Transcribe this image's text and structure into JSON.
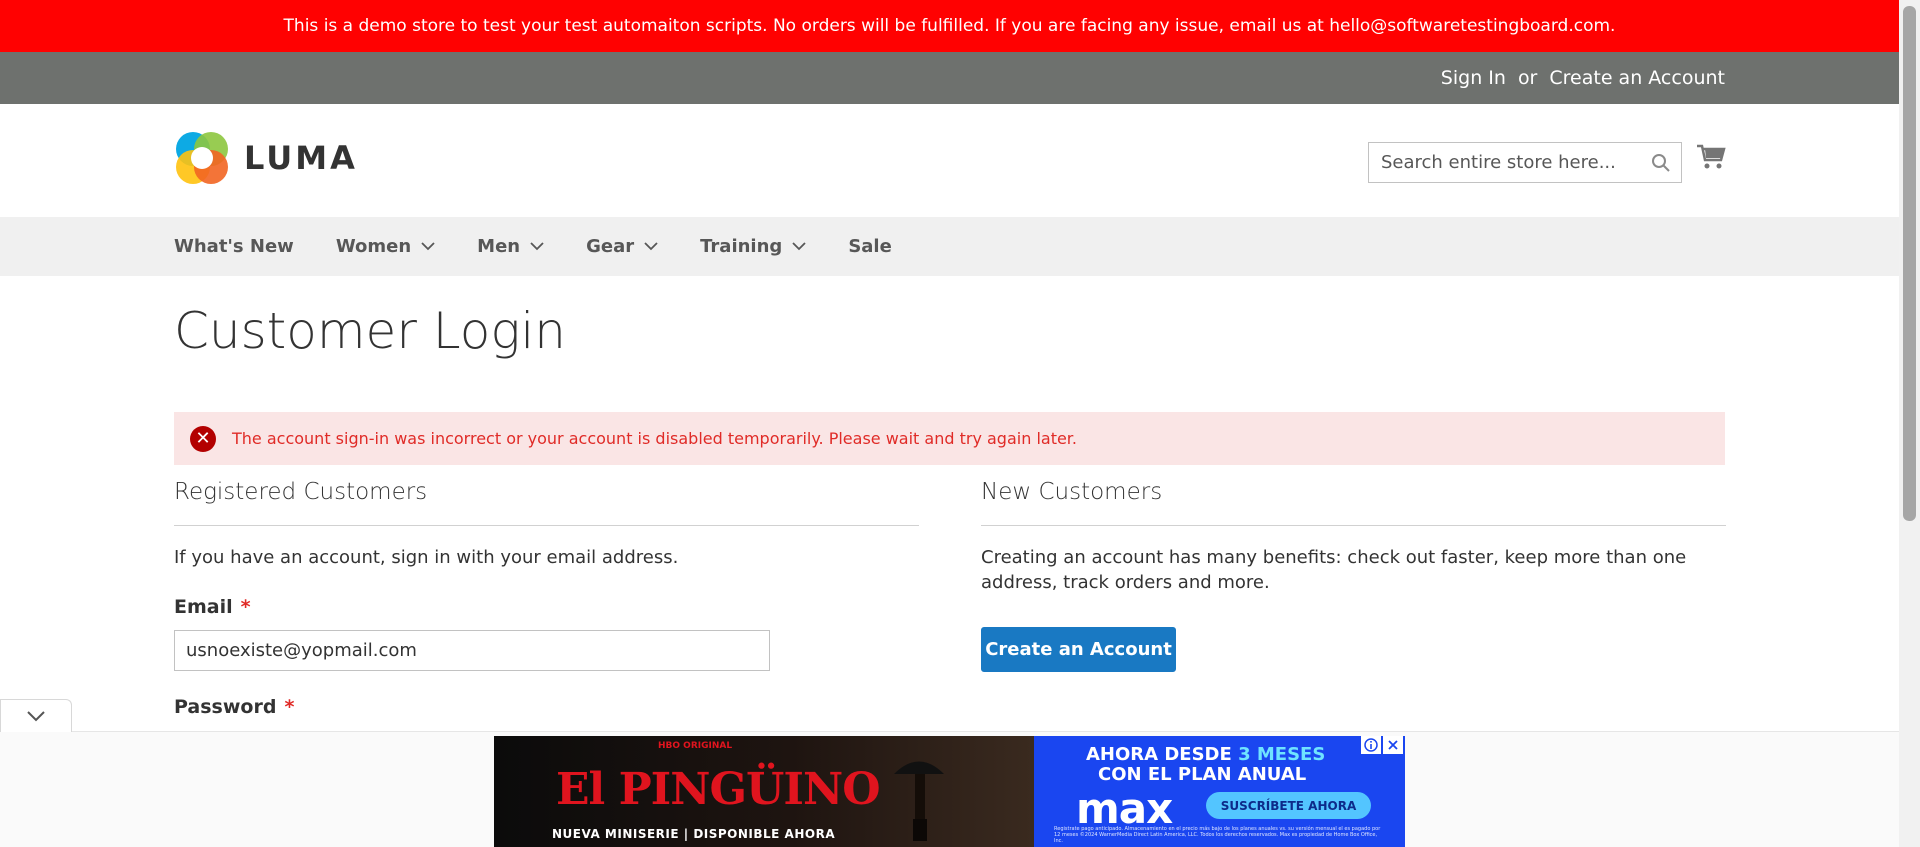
{
  "demo_notice": "This is a demo store to test your test automaiton scripts. No orders will be fulfilled. If you are facing any issue, email us at hello@softwaretestingboard.com.",
  "header": {
    "sign_in": "Sign In",
    "or": "or",
    "create_account": "Create an Account"
  },
  "logo": {
    "text": "LUMA",
    "icon": "luma-logo-icon"
  },
  "search": {
    "placeholder": "Search entire store here...",
    "icon": "search-icon"
  },
  "cart": {
    "icon": "cart-icon"
  },
  "nav": {
    "items": [
      {
        "label": "What's New",
        "has_dropdown": false
      },
      {
        "label": "Women",
        "has_dropdown": true
      },
      {
        "label": "Men",
        "has_dropdown": true
      },
      {
        "label": "Gear",
        "has_dropdown": true
      },
      {
        "label": "Training",
        "has_dropdown": true
      },
      {
        "label": "Sale",
        "has_dropdown": false
      }
    ]
  },
  "page": {
    "title": "Customer Login",
    "error": "The account sign-in was incorrect or your account is disabled temporarily. Please wait and try again later."
  },
  "registered": {
    "title": "Registered Customers",
    "intro": "If you have an account, sign in with your email address.",
    "email_label": "Email",
    "email_value": "usnoexiste@yopmail.com",
    "password_label": "Password",
    "required_mark": "*"
  },
  "new_customers": {
    "title": "New Customers",
    "text": "Creating an account has many benefits: check out faster, keep more than one address, track orders and more.",
    "button": "Create an Account"
  },
  "ad": {
    "hbo": "HBO ORIGINAL",
    "title": "El PINGÜINO",
    "subtitle": "NUEVA MINISERIE | DISPONIBLE AHORA",
    "headline_prefix": "AHORA DESDE",
    "headline_highlight": "3 MESES",
    "headline2": "CON EL PLAN ANUAL",
    "brand": "max",
    "cta": "SUSCRÍBETE AHORA",
    "fine_print": "Registrate pago anticipado. Almacenamiento en el precio más bajo de los planes anuales vs. su versión mensual el es pagado por 12 meses ©2024 WarnerMedia Direct Latin America, LLC. Todos los derechos reservados. Max es propiedad de Home Box Office, Inc."
  },
  "colors": {
    "demo_bar": "#ff0101",
    "header_panel": "#6e716e",
    "nav_bg": "#f0f0f0",
    "error_bg": "#fae5e5",
    "error_text": "#e02b27",
    "primary_button": "#1979c3",
    "ad_blue": "#1a46f0"
  }
}
